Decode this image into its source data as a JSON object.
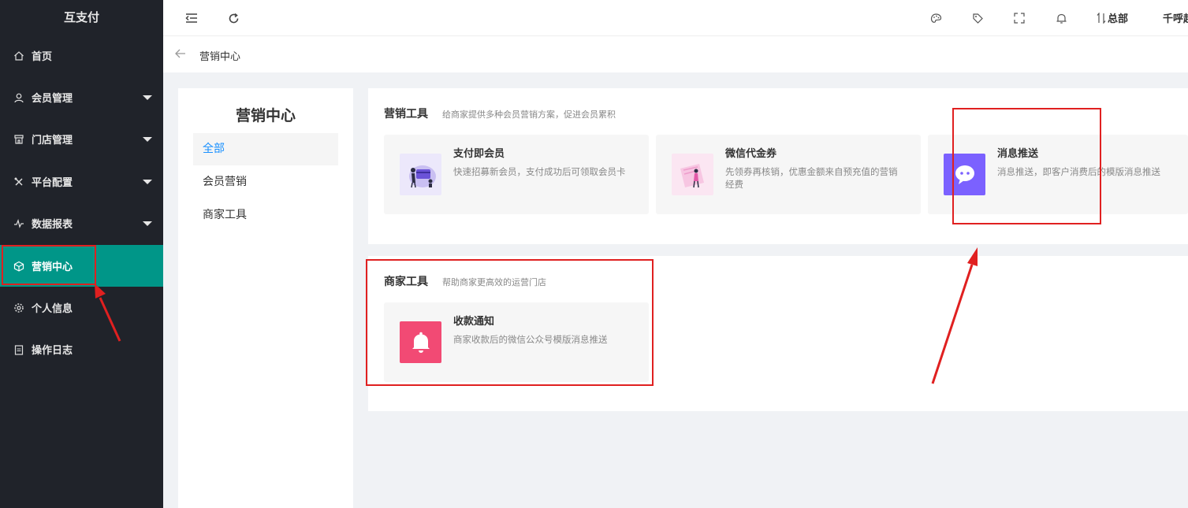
{
  "sidebar": {
    "logo": "互支付",
    "items": [
      {
        "label": "首页"
      },
      {
        "label": "会员管理"
      },
      {
        "label": "门店管理"
      },
      {
        "label": "平台配置"
      },
      {
        "label": "数据报表"
      },
      {
        "label": "营销中心"
      },
      {
        "label": "个人信息"
      },
      {
        "label": "操作日志"
      }
    ],
    "active_color": "#009688",
    "background": "#20232a"
  },
  "header": {
    "org": "总部",
    "user": "千呼起"
  },
  "breadcrumb": {
    "current": "营销中心"
  },
  "left_panel": {
    "title": "营销中心",
    "items": [
      {
        "label": "全部"
      },
      {
        "label": "会员营销"
      },
      {
        "label": "商家工具"
      }
    ]
  },
  "sections": {
    "marketing": {
      "title": "营销工具",
      "desc": "给商家提供多种会员营销方案，促进会员累积",
      "tools": [
        {
          "name": "支付即会员",
          "desc": "快速招募新会员，支付成功后可领取会员卡"
        },
        {
          "name": "微信代金券",
          "desc": "先领券再核销，优惠金额来自预充值的营销经费"
        },
        {
          "name": "消息推送",
          "desc": "消息推送，即客户消费后的模版消息推送"
        }
      ]
    },
    "merchant": {
      "title": "商家工具",
      "desc": "帮助商家更高效的运营门店",
      "tools": [
        {
          "name": "收款通知",
          "desc": "商家收款后的微信公众号模版消息推送"
        }
      ]
    }
  },
  "icons": {
    "message_bg": "#7b61ff",
    "bell_bg": "#f24a74"
  }
}
